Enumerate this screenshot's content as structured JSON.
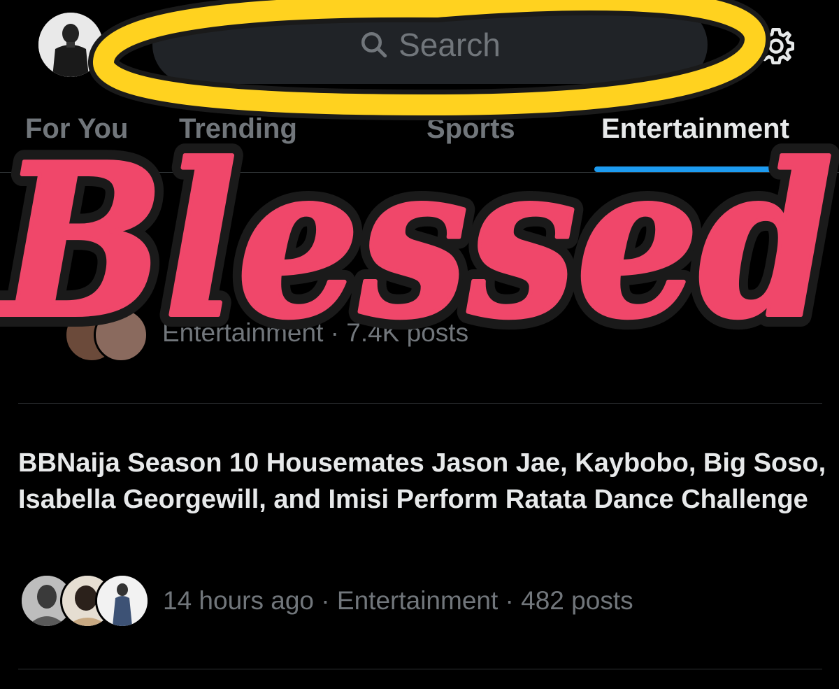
{
  "header": {
    "search_placeholder": "Search",
    "avatar_icon": "user-avatar",
    "search_icon": "search-icon",
    "settings_icon": "gear-icon"
  },
  "tabs": [
    {
      "label": "For You",
      "active": false
    },
    {
      "label": "Trending",
      "active": false
    },
    {
      "label": "Sports",
      "active": false
    },
    {
      "label": "Entertainment",
      "active": true
    }
  ],
  "accent_color": "#1d9bf0",
  "trends": [
    {
      "title": "",
      "meta": {
        "time": "",
        "category": "Entertainment",
        "posts": "7.4K posts"
      }
    },
    {
      "title": "BBNaija Season 10 Housemates Jason Jae, Kaybobo, Big Soso, Isabella Georgewill, and Imisi Perform Ratata Dance Challenge",
      "meta": {
        "time": "14 hours ago",
        "category": "Entertainment",
        "posts": "482 posts"
      }
    }
  ],
  "overlay": {
    "sticker_text": "Blessed",
    "sticker_color": "#f0476a",
    "halo_color": "#ffd21f"
  }
}
